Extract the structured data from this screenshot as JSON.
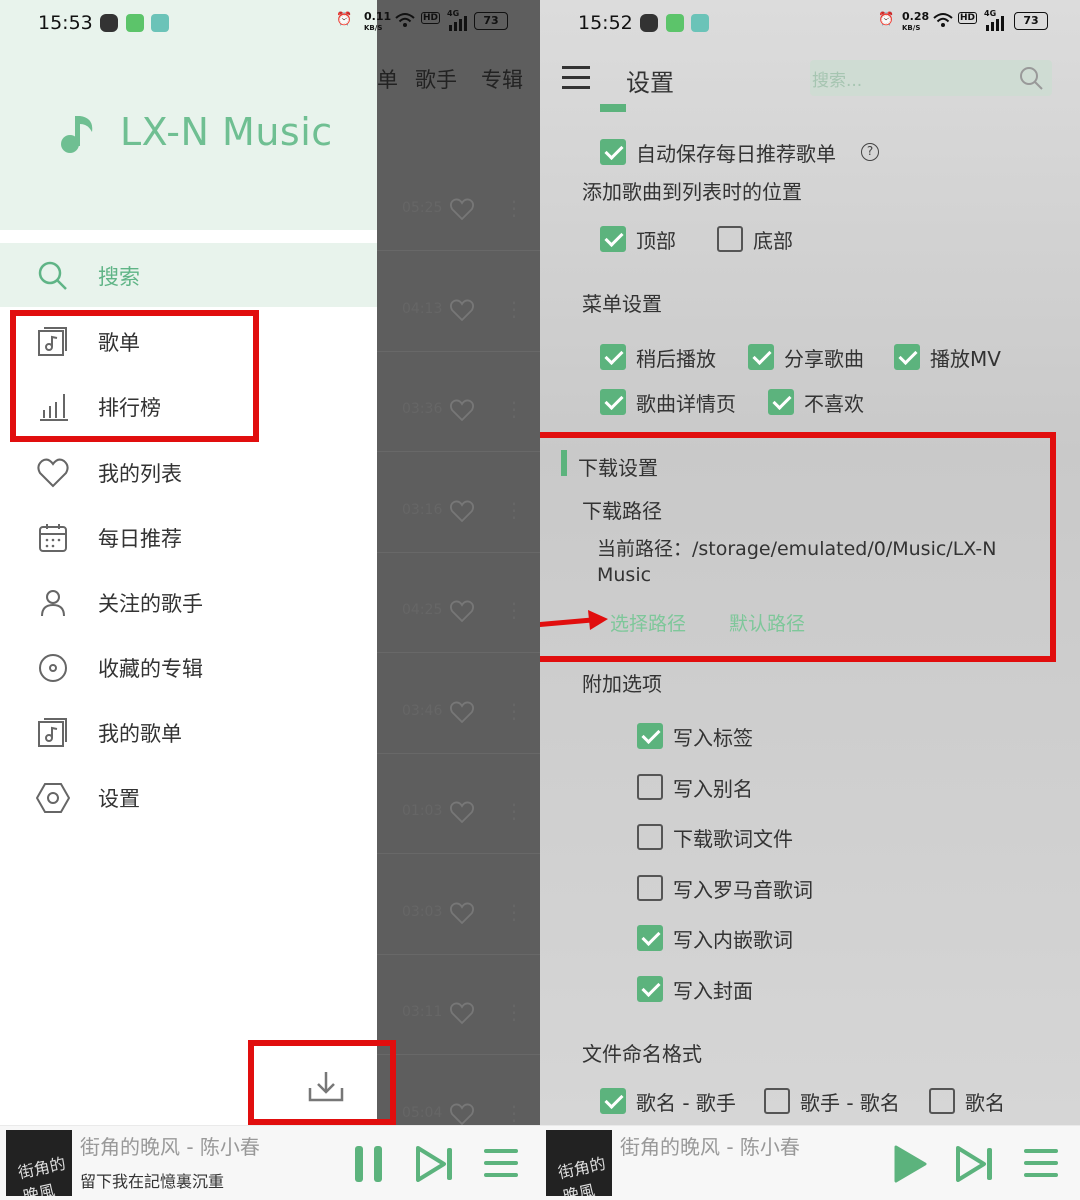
{
  "left": {
    "status": {
      "time": "15:53",
      "speed": "0.11",
      "speed_unit": "KB/S",
      "hd": "HD",
      "net": "4G",
      "battery": "73"
    },
    "app_name": "LX-N Music",
    "nav": [
      {
        "label": "搜索",
        "icon": "search-icon",
        "active": true
      },
      {
        "label": "歌单",
        "icon": "songlist-icon"
      },
      {
        "label": "排行榜",
        "icon": "chart-icon"
      },
      {
        "label": "我的列表",
        "icon": "heart-icon"
      },
      {
        "label": "每日推荐",
        "icon": "calendar-icon"
      },
      {
        "label": "关注的歌手",
        "icon": "person-icon"
      },
      {
        "label": "收藏的专辑",
        "icon": "disc-icon"
      },
      {
        "label": "我的歌单",
        "icon": "songlist-icon"
      },
      {
        "label": "设置",
        "icon": "hexagon-settings-icon"
      }
    ],
    "background_tabs": [
      "单",
      "歌手",
      "专辑"
    ],
    "background_durations": [
      "05:25",
      "04:13",
      "03:36",
      "03:16",
      "04:25",
      "03:46",
      "01:03",
      "03:03",
      "03:11",
      "05:04"
    ],
    "download_icon": "download-icon",
    "player": {
      "song": "街角的晚风 - 陈小春",
      "lyric": "留下我在記憶裏沉重",
      "cover_text": "街角的晚風"
    }
  },
  "right": {
    "status": {
      "time": "15:52",
      "speed": "0.28",
      "speed_unit": "KB/S",
      "hd": "HD",
      "net": "4G",
      "battery": "73"
    },
    "title": "设置",
    "search_placeholder": "搜索...",
    "auto_save_daily": "自动保存每日推荐歌单",
    "add_position": {
      "title": "添加歌曲到列表时的位置",
      "options": [
        {
          "label": "顶部",
          "checked": true
        },
        {
          "label": "底部",
          "checked": false
        }
      ]
    },
    "menu_settings": {
      "title": "菜单设置",
      "options": [
        {
          "label": "稍后播放",
          "checked": true
        },
        {
          "label": "分享歌曲",
          "checked": true
        },
        {
          "label": "播放MV",
          "checked": true
        },
        {
          "label": "歌曲详情页",
          "checked": true
        },
        {
          "label": "不喜欢",
          "checked": true
        }
      ]
    },
    "download": {
      "title": "下载设置",
      "path_title": "下载路径",
      "current_path": "当前路径：/storage/emulated/0/Music/LX-N Music",
      "choose_path": "选择路径",
      "default_path": "默认路径"
    },
    "extra": {
      "title": "附加选项",
      "options": [
        {
          "label": "写入标签",
          "checked": true
        },
        {
          "label": "写入别名",
          "checked": false
        },
        {
          "label": "下载歌词文件",
          "checked": false
        },
        {
          "label": "写入罗马音歌词",
          "checked": false
        },
        {
          "label": "写入内嵌歌词",
          "checked": true
        },
        {
          "label": "写入封面",
          "checked": true
        }
      ]
    },
    "naming": {
      "title": "文件命名格式",
      "options": [
        {
          "label": "歌名 - 歌手",
          "checked": true
        },
        {
          "label": "歌手 - 歌名",
          "checked": false
        },
        {
          "label": "歌名",
          "checked": false
        }
      ]
    },
    "player": {
      "song": "街角的晚风 - 陈小春",
      "cover_text": "街角的晚風"
    }
  },
  "colors": {
    "accent": "#5cb37d",
    "annotation_red": "#e10e0e"
  }
}
